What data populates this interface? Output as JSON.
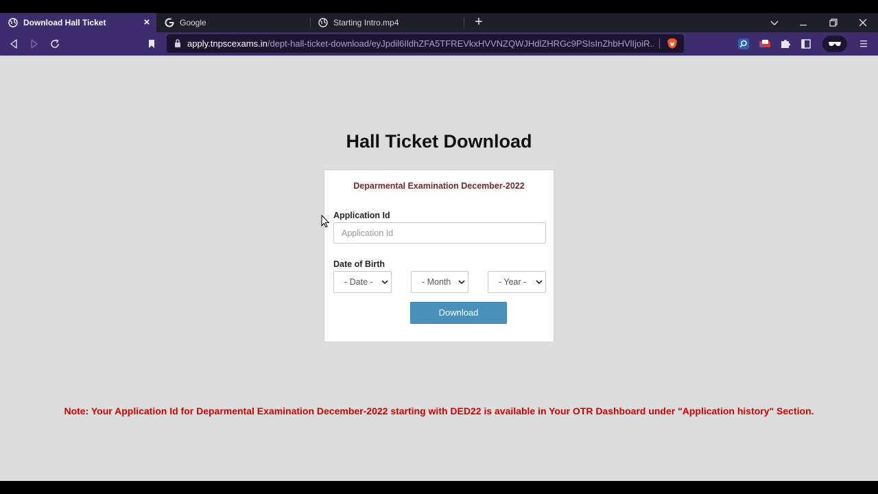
{
  "browser": {
    "tabs": [
      {
        "title": "Download Hall Ticket",
        "active": true
      },
      {
        "title": "Google",
        "active": false
      },
      {
        "title": "Starting Intro.mp4",
        "active": false
      }
    ],
    "close_glyph": "×",
    "new_tab_glyph": "+",
    "url_host": "apply.tnpscexams.in",
    "url_path": "/dept-hall-ticket-download/eyJpdil6IldhZFA5TFREVkxHVVNZQWJHdlZHRGc9PSIsInZhbHVlIjoiR...",
    "accent": "#3d2c6e"
  },
  "page": {
    "title": "Hall Ticket Download",
    "exam_heading": "Deparmental Examination December-2022",
    "application_id_label": "Application Id",
    "application_id_placeholder": "Application Id",
    "application_id_value": "",
    "dob_label": "Date of Birth",
    "date_select": "- Date -",
    "month_select": "- Month",
    "year_select": "- Year -",
    "download_label": "Download",
    "note": "Note: Your Application Id for Deparmental Examination December-2022 starting with DED22 is available in Your OTR Dashboard under \"Application history\" Section.",
    "button_color": "#4a90bd",
    "note_color": "#d10000"
  }
}
